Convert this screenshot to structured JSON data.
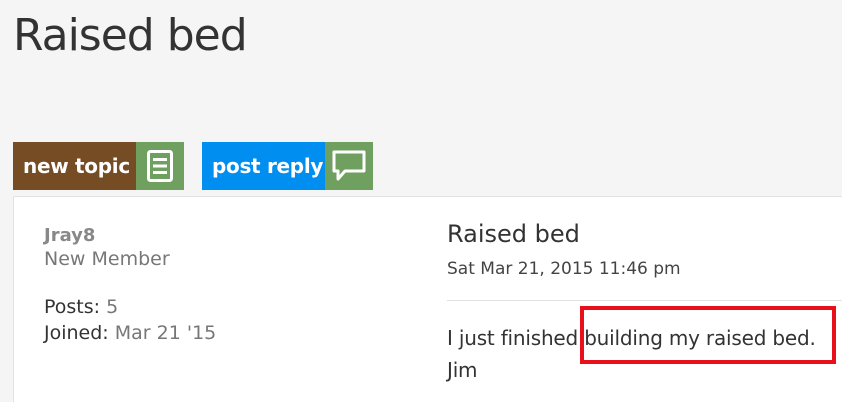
{
  "page": {
    "title": "Raised bed"
  },
  "actions": {
    "new_topic_label": "new topic",
    "post_reply_label": "post reply",
    "new_topic_icon": "document-lines-icon",
    "post_reply_icon": "speech-bubble-icon"
  },
  "author": {
    "name": "Jray8",
    "rank": "New Member",
    "posts_label": "Posts:",
    "posts_value": "5",
    "joined_label": "Joined:",
    "joined_value": "Mar 21 '15"
  },
  "post": {
    "title": "Raised bed",
    "date": "Sat Mar 21, 2015 11:46 pm",
    "body_line1": "I just finished building my raised bed.",
    "body_line2": "Jim"
  },
  "colors": {
    "new_topic": "#754c24",
    "post_reply": "#008ef0",
    "icon_bg": "#6fa060",
    "highlight": "#e8101b"
  }
}
